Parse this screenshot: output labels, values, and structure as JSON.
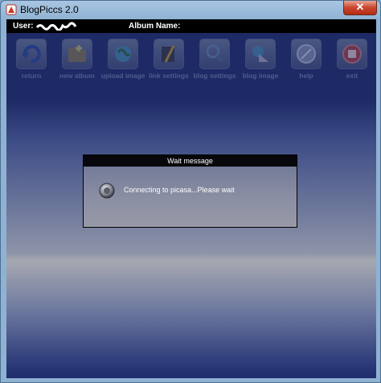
{
  "window": {
    "title": "BlogPiccs 2.0",
    "close_glyph": "✕"
  },
  "infobar": {
    "user_label": "User:",
    "album_label": "Album Name:",
    "album_value": ""
  },
  "toolbar": [
    {
      "label": "return",
      "icon": "return-icon"
    },
    {
      "label": "new album",
      "icon": "new-album-icon"
    },
    {
      "label": "upload image",
      "icon": "upload-image-icon"
    },
    {
      "label": "link settings",
      "icon": "link-settings-icon"
    },
    {
      "label": "blog settings",
      "icon": "blog-settings-icon"
    },
    {
      "label": "blog image",
      "icon": "blog-image-icon"
    },
    {
      "label": "help",
      "icon": "help-icon"
    },
    {
      "label": "exit",
      "icon": "exit-icon"
    }
  ],
  "dialog": {
    "title": "Wait message",
    "message": "Connecting to picasa...Please wait"
  }
}
